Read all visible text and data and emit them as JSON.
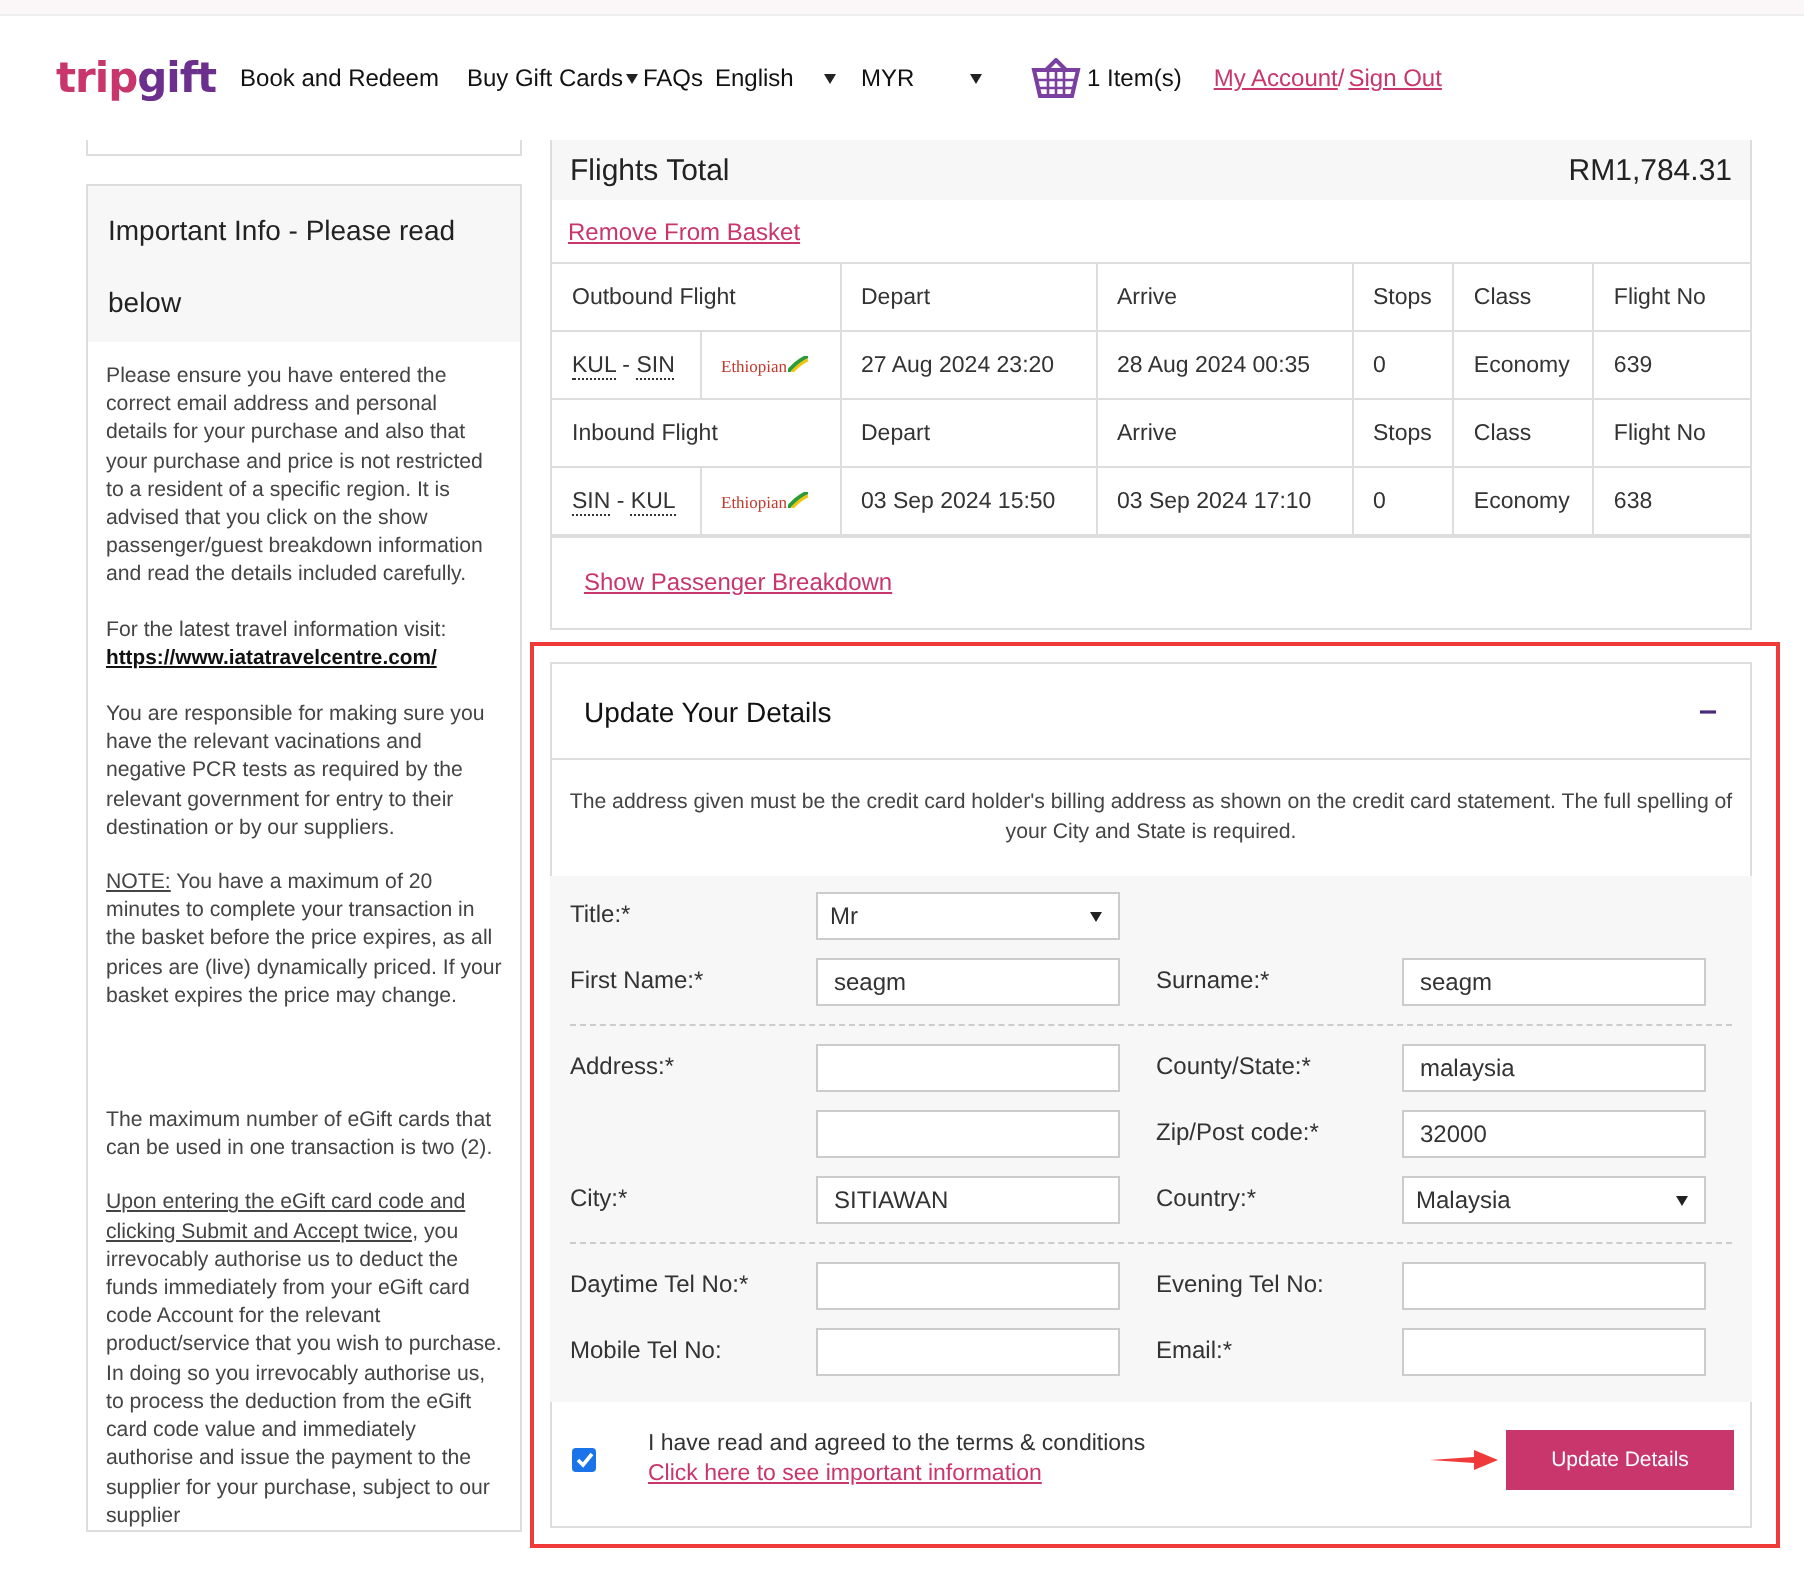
{
  "header": {
    "logo": {
      "part_1": "trip",
      "part_2": "gift"
    },
    "nav": [
      {
        "label": "Book and Redeem",
        "kind": "link"
      },
      {
        "label": "Buy Gift Cards",
        "kind": "dropdown"
      },
      {
        "label": "FAQs",
        "kind": "link"
      }
    ],
    "language": {
      "value": "English"
    },
    "currency": {
      "value": "MYR"
    },
    "basket": {
      "label": "1 Item(s)"
    },
    "account_link": "My Account",
    "separator": "/",
    "sign_out_link": "Sign Out"
  },
  "sidebar": {
    "title": "Important Info - Please read below",
    "paragraphs": [
      {
        "kind": "plain",
        "text": "Please ensure you have entered the correct email address and personal details for your purchase and also that your purchase and price is not restricted to a resident of a specific region. It is advised that you click on the show passenger/guest breakdown information and read the details included carefully."
      },
      {
        "kind": "link",
        "text": "For the latest travel information visit:",
        "link": "https://www.iatatravelcentre.com/"
      },
      {
        "kind": "plain",
        "text": "You are responsible for making sure you have the relevant vacinations and negative PCR tests as required by the relevant government for entry to their destination or by our suppliers."
      },
      {
        "kind": "lead",
        "lead": "NOTE:",
        "text": "You have a maximum of 20 minutes to complete your transaction in the basket before the price expires, as all prices are (live) dynamically priced. If your basket expires the price may change."
      },
      {
        "kind": "spacer"
      },
      {
        "kind": "plain",
        "text": "The maximum number of eGift cards that can be used in one transaction is two (2)."
      },
      {
        "kind": "lead",
        "lead": "Upon entering the eGift card code and clicking Submit and Accept twice,",
        "text": "you irrevocably authorise us to deduct the funds immediately from your eGift card code Account for the relevant product/service that you wish to purchase. In doing so you irrevocably authorise us, to process the deduction from the eGift card code value and immediately authorise and issue the payment to the supplier for your purchase, subject to our supplier"
      }
    ]
  },
  "flights": {
    "title": "Flights Total",
    "total": "RM1,784.31",
    "remove_link": "Remove From Basket",
    "segments": [
      {
        "heading": "Outbound Flight",
        "columns": [
          "Depart",
          "Arrive",
          "Stops",
          "Class",
          "Flight No"
        ],
        "route": [
          "KUL",
          "-",
          "SIN"
        ],
        "airline": "Ethiopian",
        "cells": [
          "27 Aug 2024 23:20",
          "28 Aug 2024 00:35",
          "0",
          "Economy",
          "639"
        ]
      },
      {
        "heading": "Inbound Flight",
        "columns": [
          "Depart",
          "Arrive",
          "Stops",
          "Class",
          "Flight No"
        ],
        "route": [
          "SIN",
          "-",
          "KUL"
        ],
        "airline": "Ethiopian",
        "cells": [
          "03 Sep 2024 15:50",
          "03 Sep 2024 17:10",
          "0",
          "Economy",
          "638"
        ]
      }
    ],
    "breakdown_link": "Show Passenger Breakdown"
  },
  "details": {
    "title": "Update Your Details",
    "expanded": true,
    "notice": "The address given must be the credit card holder's billing address as shown on the credit card statement. The full spelling of your City and State is required.",
    "groups": [
      [
        {
          "cells": [
            {
              "label": "Title:*",
              "kind": "select",
              "value": "Mr"
            }
          ]
        },
        {
          "cells": [
            {
              "label": "First Name:*",
              "kind": "text",
              "value": "seagm"
            },
            {
              "label": "Surname:*",
              "kind": "text",
              "value": "seagm"
            }
          ]
        }
      ],
      [
        {
          "cells": [
            {
              "label": "Address:*",
              "kind": "text"
            },
            {
              "label": "County/State:*",
              "kind": "text",
              "value": "malaysia"
            }
          ]
        },
        {
          "cells": [
            {
              "kind": "text"
            },
            {
              "label": "Zip/Post code:*",
              "kind": "text",
              "value": "32000"
            }
          ]
        },
        {
          "cells": [
            {
              "label": "City:*",
              "kind": "text",
              "value": "SITIAWAN"
            },
            {
              "label": "Country:*",
              "kind": "select",
              "value": "Malaysia"
            }
          ]
        }
      ],
      [
        {
          "cells": [
            {
              "label": "Daytime Tel No:*",
              "kind": "text"
            },
            {
              "label": "Evening Tel No:",
              "kind": "text"
            }
          ]
        },
        {
          "cells": [
            {
              "label": "Mobile Tel No:",
              "kind": "text"
            },
            {
              "label": "Email:*",
              "kind": "text"
            }
          ]
        }
      ]
    ],
    "terms": {
      "checked": true,
      "text": "I have read and agreed to the terms & conditions",
      "link": "Click here to see important information"
    },
    "submit": "Update Details"
  }
}
